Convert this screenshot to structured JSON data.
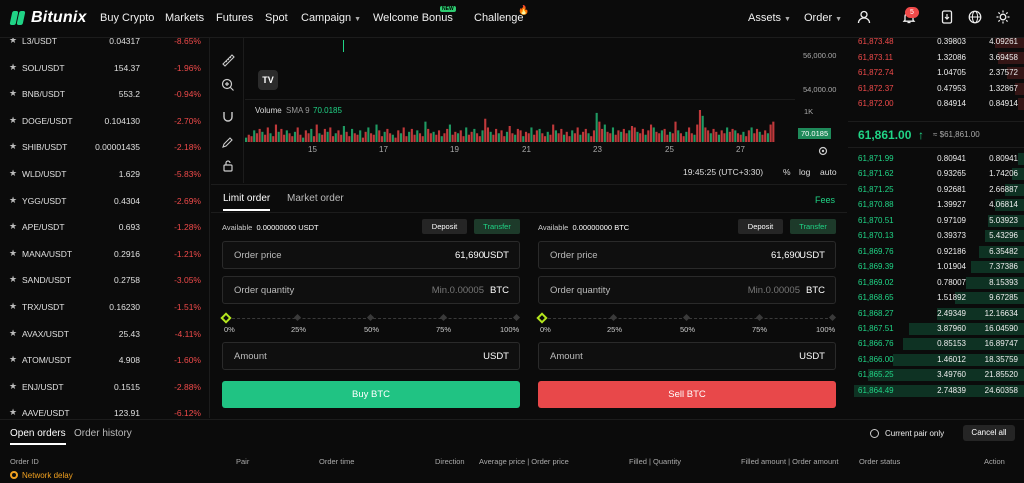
{
  "brand": {
    "name": "Bitunix",
    "green": "#20d486",
    "red": "#ef4a4a"
  },
  "nav": {
    "buy_crypto": "Buy Crypto",
    "markets": "Markets",
    "futures": "Futures",
    "spot": "Spot",
    "campaign": "Campaign",
    "welcome_bonus": "Welcome Bonus",
    "new_badge": "NEW",
    "challenge": "Challenge",
    "assets": "Assets",
    "order": "Order",
    "notification_count": "5"
  },
  "watchlist": [
    {
      "pair": "L3/USDT",
      "price": "0.04317",
      "change": "-8.65%"
    },
    {
      "pair": "SOL/USDT",
      "price": "154.37",
      "change": "-1.96%"
    },
    {
      "pair": "BNB/USDT",
      "price": "553.2",
      "change": "-0.94%"
    },
    {
      "pair": "DOGE/USDT",
      "price": "0.104130",
      "change": "-2.70%"
    },
    {
      "pair": "SHIB/USDT",
      "price": "0.00001435",
      "change": "-2.18%"
    },
    {
      "pair": "WLD/USDT",
      "price": "1.629",
      "change": "-5.83%"
    },
    {
      "pair": "YGG/USDT",
      "price": "0.4304",
      "change": "-2.69%"
    },
    {
      "pair": "APE/USDT",
      "price": "0.693",
      "change": "-1.28%"
    },
    {
      "pair": "MANA/USDT",
      "price": "0.2916",
      "change": "-1.21%"
    },
    {
      "pair": "SAND/USDT",
      "price": "0.2758",
      "change": "-3.05%"
    },
    {
      "pair": "TRX/USDT",
      "price": "0.16230",
      "change": "-1.51%"
    },
    {
      "pair": "AVAX/USDT",
      "price": "25.43",
      "change": "-4.11%"
    },
    {
      "pair": "ATOM/USDT",
      "price": "4.908",
      "change": "-1.60%"
    },
    {
      "pair": "ENJ/USDT",
      "price": "0.1515",
      "change": "-2.88%"
    },
    {
      "pair": "AAVE/USDT",
      "price": "123.91",
      "change": "-6.12%"
    }
  ],
  "chart": {
    "price_ticks": [
      "56,000.00",
      "54,000.00"
    ],
    "volume_label": "Volume",
    "volume_sma": "SMA 9",
    "volume_value": "70.0185",
    "volume_axis": "1K",
    "date_ticks": [
      "15",
      "17",
      "19",
      "21",
      "23",
      "25",
      "27"
    ],
    "time": "19:45:25 (UTC+3:30)",
    "pct": "%",
    "log": "log",
    "auto": "auto",
    "volumes": [
      3,
      5,
      4,
      8,
      6,
      9,
      7,
      5,
      10,
      6,
      4,
      12,
      7,
      9,
      5,
      8,
      6,
      4,
      7,
      10,
      5,
      3,
      8,
      6,
      9,
      4,
      12,
      6,
      5,
      9,
      7,
      10,
      4,
      6,
      8,
      5,
      11,
      7,
      4,
      9,
      6,
      5,
      8,
      3,
      7,
      10,
      6,
      5,
      12,
      8,
      4,
      7,
      9,
      6,
      5,
      3,
      8,
      6,
      10,
      4,
      7,
      9,
      5,
      8,
      6,
      4,
      14,
      9,
      6,
      7,
      5,
      8,
      4,
      6,
      9,
      12,
      5,
      7,
      6,
      8,
      4,
      10,
      5,
      7,
      9,
      6,
      4,
      8,
      16,
      10,
      7,
      5,
      9,
      6,
      8,
      4,
      7,
      11,
      6,
      5,
      9,
      8,
      4,
      7,
      6,
      10,
      5,
      8,
      9,
      6,
      4,
      7,
      5,
      12,
      8,
      6,
      9,
      5,
      7,
      4,
      8,
      6,
      10,
      5,
      7,
      9,
      6,
      4,
      8,
      20,
      14,
      9,
      12,
      7,
      6,
      10,
      5,
      8,
      7,
      9,
      6,
      8,
      11,
      10,
      7,
      6,
      9,
      5,
      8,
      12,
      10,
      7,
      6,
      8,
      9,
      5,
      7,
      6,
      14,
      8,
      6,
      4,
      7,
      10,
      6,
      5,
      12,
      22,
      18,
      10,
      8,
      6,
      9,
      7,
      5,
      8,
      6,
      10,
      7,
      9,
      8,
      6,
      5,
      7,
      4,
      8,
      10,
      6,
      9,
      7,
      5,
      8,
      6,
      12,
      14
    ]
  },
  "order_form": {
    "tab_limit": "Limit order",
    "tab_market": "Market order",
    "fees": "Fees",
    "buy": {
      "available_label": "Available",
      "available_value": "0.00000000 USDT",
      "deposit": "Deposit",
      "transfer": "Transfer",
      "price_label": "Order price",
      "price_value": "61,690",
      "price_unit": "USDT",
      "qty_label": "Order quantity",
      "qty_placeholder": "Min.0.00005",
      "qty_unit": "BTC",
      "amount_label": "Amount",
      "amount_unit": "USDT",
      "action": "Buy BTC",
      "slider_pct": 0
    },
    "sell": {
      "available_label": "Available",
      "available_value": "0.00000000 BTC",
      "deposit": "Deposit",
      "transfer": "Transfer",
      "price_label": "Order price",
      "price_value": "61,690",
      "price_unit": "USDT",
      "qty_label": "Order quantity",
      "qty_placeholder": "Min.0.00005",
      "qty_unit": "BTC",
      "amount_label": "Amount",
      "amount_unit": "USDT",
      "action": "Sell BTC",
      "slider_pct": 0
    },
    "slider_labels": [
      "0%",
      "25%",
      "50%",
      "75%",
      "100%"
    ]
  },
  "orderbook": {
    "asks": [
      {
        "price": "61,873.48",
        "amount": "0.39803",
        "total": "4.09261"
      },
      {
        "price": "61,873.11",
        "amount": "1.32086",
        "total": "3.69458"
      },
      {
        "price": "61,872.74",
        "amount": "1.04705",
        "total": "2.37572"
      },
      {
        "price": "61,872.37",
        "amount": "0.47953",
        "total": "1.32867"
      },
      {
        "price": "61,872.00",
        "amount": "0.84914",
        "total": "0.84914"
      }
    ],
    "mid_price": "61,861.00",
    "mid_arrow": "↑",
    "mid_fiat": "≈ $61,861.00",
    "bids": [
      {
        "price": "61,871.99",
        "amount": "0.80941",
        "total": "0.80941"
      },
      {
        "price": "61,871.62",
        "amount": "0.93265",
        "total": "1.74206"
      },
      {
        "price": "61,871.25",
        "amount": "0.92681",
        "total": "2.66887"
      },
      {
        "price": "61,870.88",
        "amount": "1.39927",
        "total": "4.06814"
      },
      {
        "price": "61,870.51",
        "amount": "0.97109",
        "total": "5.03923"
      },
      {
        "price": "61,870.13",
        "amount": "0.39373",
        "total": "5.43296"
      },
      {
        "price": "61,869.76",
        "amount": "0.92186",
        "total": "6.35482"
      },
      {
        "price": "61,869.39",
        "amount": "1.01904",
        "total": "7.37386"
      },
      {
        "price": "61,869.02",
        "amount": "0.78007",
        "total": "8.15393"
      },
      {
        "price": "61,868.65",
        "amount": "1.51892",
        "total": "9.67285"
      },
      {
        "price": "61,868.27",
        "amount": "2.49349",
        "total": "12.16634"
      },
      {
        "price": "61,867.51",
        "amount": "3.87960",
        "total": "16.04590"
      },
      {
        "price": "61,866.76",
        "amount": "0.85153",
        "total": "16.89747"
      },
      {
        "price": "61,866.00",
        "amount": "1.46012",
        "total": "18.35759"
      },
      {
        "price": "61,865.25",
        "amount": "3.49760",
        "total": "21.85520"
      },
      {
        "price": "61,864.49",
        "amount": "2.74839",
        "total": "24.60358"
      }
    ]
  },
  "orders": {
    "tab_open": "Open orders",
    "tab_history": "Order history",
    "current_pair": "Current pair only",
    "cancel_all": "Cancel all",
    "columns": [
      "Order ID",
      "Pair",
      "Order time",
      "Direction",
      "Average price | Order price",
      "Filled | Quantity",
      "Filled amount | Order amount",
      "Order status",
      "Action"
    ],
    "network": "Network delay"
  }
}
